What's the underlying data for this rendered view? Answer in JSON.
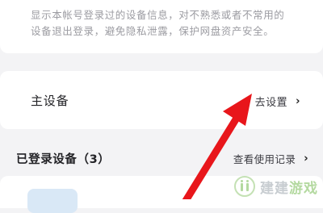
{
  "info": {
    "line1": "显示本帐号登录过的设备信息，对不熟悉或者不常用的",
    "line2": "设备退出登录，避免隐私泄露，保护网盘资产安全。"
  },
  "main_device": {
    "title": "主设备",
    "setup_label": "去设置",
    "chevron": "›"
  },
  "logged_devices": {
    "title": "已登录设备（3）",
    "view_label": "查看使用记录",
    "chevron": "›"
  },
  "watermark": {
    "text_part1": "建建",
    "text_part2": "游戏"
  },
  "colors": {
    "annotation_arrow": "#e8161b",
    "background": "#f3f3f5",
    "card": "#ffffff"
  },
  "icons": {
    "setup_chevron": "chevron-right-icon",
    "view_chevron": "chevron-right-icon",
    "annotation": "red-arrow-icon",
    "watermark_logo": "watermark-logo-icon"
  }
}
